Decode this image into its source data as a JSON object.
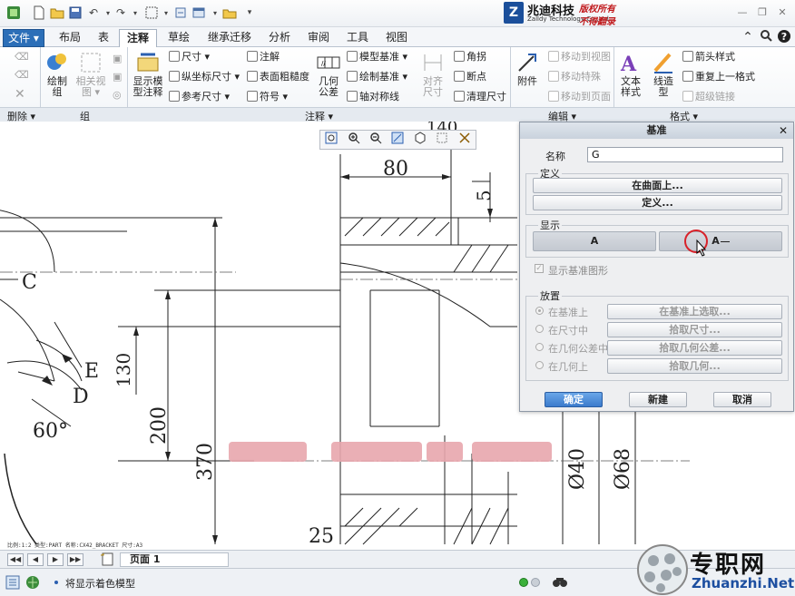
{
  "titlebar": {
    "logo_letter": "Z",
    "brand_cn": "兆迪科技",
    "brand_en": "Zalldy Technology Co.,Ltd.",
    "rights_1": "版权所有",
    "rights_2": "不得翻录"
  },
  "tabs": [
    {
      "label": "文件 ▾"
    },
    {
      "label": "布局"
    },
    {
      "label": "表"
    },
    {
      "label": "注释"
    },
    {
      "label": "草绘"
    },
    {
      "label": "继承迁移"
    },
    {
      "label": "分析"
    },
    {
      "label": "审阅"
    },
    {
      "label": "工具"
    },
    {
      "label": "视图"
    }
  ],
  "ribbon": {
    "delete_group": "删除 ▾",
    "group_group": "组",
    "annotate_group": "注释 ▾",
    "edit_group": "编辑 ▾",
    "format_group": "格式 ▾",
    "draw_group": "绘制\n组",
    "related_view": "相关视\n图 ▾",
    "show_model_annot": "显示模\n型注释",
    "dimension": "尺寸 ▾",
    "ordinate_dim": "纵坐标尺寸 ▾",
    "ref_dim": "参考尺寸 ▾",
    "note": "注解",
    "surface_finish": "表面粗糙度",
    "symbol": "符号 ▾",
    "gtol": "几何\n公差",
    "model_datum": "模型基准 ▾",
    "draw_datum": "绘制基准 ▾",
    "axis_sym": "轴对称线",
    "align_dim": "对齐\n尺寸",
    "corner": "角拐",
    "breakpoint": "断点",
    "clean_dim": "清理尺寸",
    "attach": "附件",
    "move_to_view": "移动到视图",
    "move_special": "移动特殊",
    "move_to_page": "移动到页面",
    "text_style": "文本\n样式",
    "line_type": "线造\n型",
    "arrow_style": "箭头样式",
    "repeat_format": "重复上一格式",
    "hyperlink": "超级链接"
  },
  "drawing": {
    "dims": [
      "80",
      "5",
      "130",
      "200",
      "370",
      "60°",
      "Ø40",
      "Ø68",
      "25",
      "140"
    ],
    "labels": [
      "C",
      "E",
      "D"
    ],
    "footer_text": "比例:1:2   类型:PART   名称:CX42_BRACKET   尺寸:A3"
  },
  "dialog": {
    "title": "基准",
    "name_label": "名称",
    "name_value": "G",
    "define_section": "定义",
    "on_surface_btn": "在曲面上...",
    "define_btn": "定义...",
    "display_section": "显示",
    "display_a": "A",
    "display_a2": "A",
    "show_datum_check": "显示基准图形",
    "placement_section": "放置",
    "opt_on_datum": "在基准上",
    "opt_on_dim": "在尺寸中",
    "opt_on_gtol": "在几何公差中",
    "opt_on_geom": "在几何上",
    "btn_pick_datum": "在基准上选取...",
    "btn_pick_dim": "拾取尺寸...",
    "btn_pick_gtol": "拾取几何公差...",
    "btn_pick_geom": "拾取几何...",
    "ok": "确定",
    "new": "新建",
    "cancel": "取消"
  },
  "pagebar": {
    "page_label": "页面 1"
  },
  "status": {
    "message": "将显示着色模型"
  },
  "watermark": {
    "cn": "专职网",
    "url": "Zhuanzhi.Net"
  }
}
